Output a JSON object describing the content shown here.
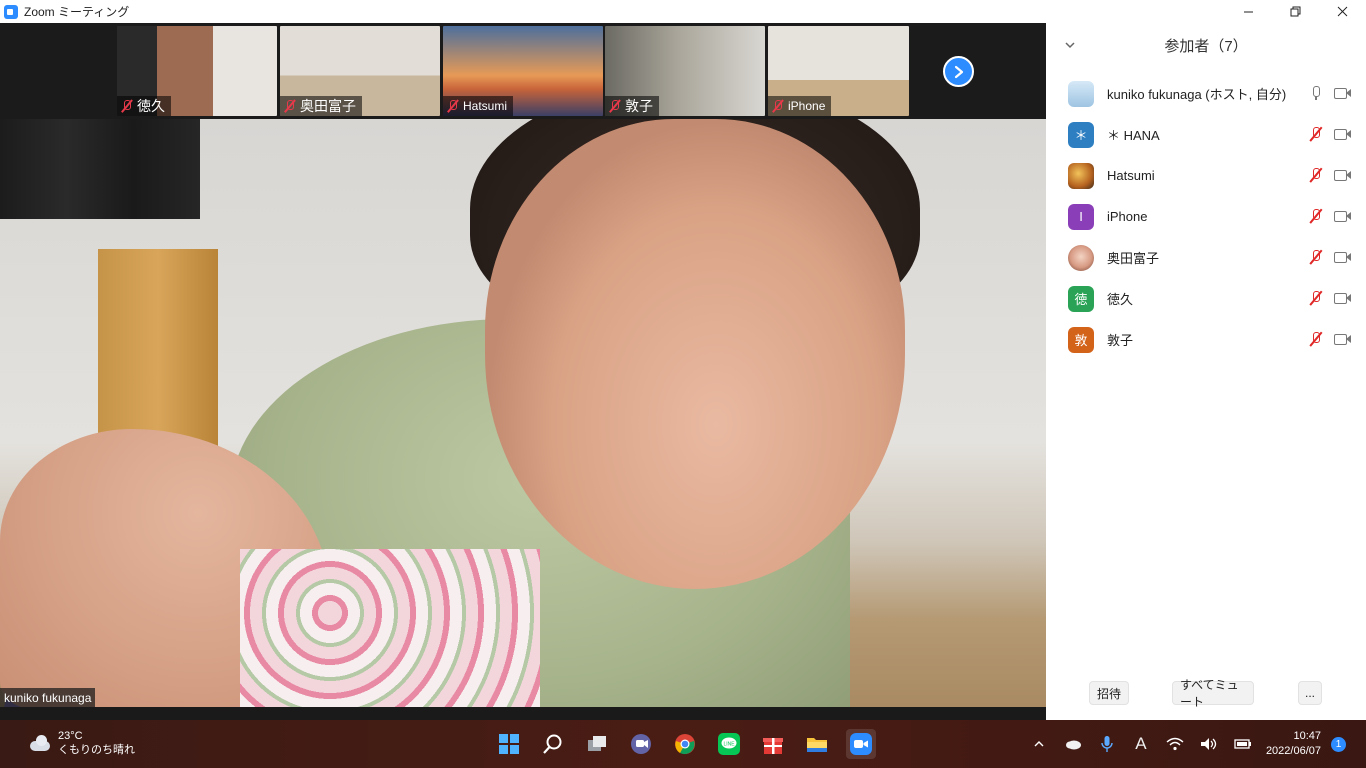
{
  "window": {
    "title": "Zoom ミーティング",
    "app_icon": "zoom-icon",
    "buttons": [
      "minimize-icon",
      "restore-icon",
      "close-icon"
    ]
  },
  "thumbnails": [
    {
      "name": "徳久",
      "muted": true
    },
    {
      "name": "奥田富子",
      "muted": true
    },
    {
      "name": "Hatsumi",
      "muted": true
    },
    {
      "name": "敦子",
      "muted": true
    },
    {
      "name": "iPhone",
      "muted": true
    }
  ],
  "gallery_next_icon": "chevron-right-icon",
  "active_speaker": {
    "name": "kuniko fukunaga"
  },
  "participants": {
    "title": "参加者（7）",
    "collapse_icon": "chevron-down-icon",
    "list": [
      {
        "name": "kuniko fukunaga (ホスト, 自分)",
        "avatar_text": "",
        "avatar_color": "#bcd8ef",
        "mic_muted": false
      },
      {
        "name": "＊ HANA",
        "avatar_text": "＊",
        "avatar_color": "#2e7fc2",
        "mic_muted": true
      },
      {
        "name": "Hatsumi",
        "avatar_text": "",
        "avatar_color": "#c8732e",
        "mic_muted": true
      },
      {
        "name": "iPhone",
        "avatar_text": "I",
        "avatar_color": "#8a3fb8",
        "mic_muted": true
      },
      {
        "name": "奥田富子",
        "avatar_text": "",
        "avatar_color": "#e9c4b6",
        "mic_muted": true
      },
      {
        "name": "徳久",
        "avatar_text": "徳",
        "avatar_color": "#2aa356",
        "mic_muted": true
      },
      {
        "name": "敦子",
        "avatar_text": "敦",
        "avatar_color": "#d4631a",
        "mic_muted": true
      }
    ],
    "footer": {
      "invite": "招待",
      "mute_all": "すべてミュート",
      "more": "..."
    }
  },
  "taskbar": {
    "weather": {
      "temp": "23°C",
      "condition": "くもりのち晴れ"
    },
    "apps": [
      "windows-start-icon",
      "search-icon",
      "task-view-icon",
      "teams-chat-icon",
      "chrome-icon",
      "line-icon",
      "gift-icon",
      "file-explorer-icon",
      "zoom-icon"
    ],
    "tray": [
      "chevron-up-icon",
      "onedrive-icon",
      "microphone-icon",
      "ime-icon",
      "wifi-icon",
      "volume-icon",
      "battery-icon"
    ],
    "ime": "A",
    "time": "10:47",
    "date": "2022/06/07",
    "notifications": "1"
  }
}
